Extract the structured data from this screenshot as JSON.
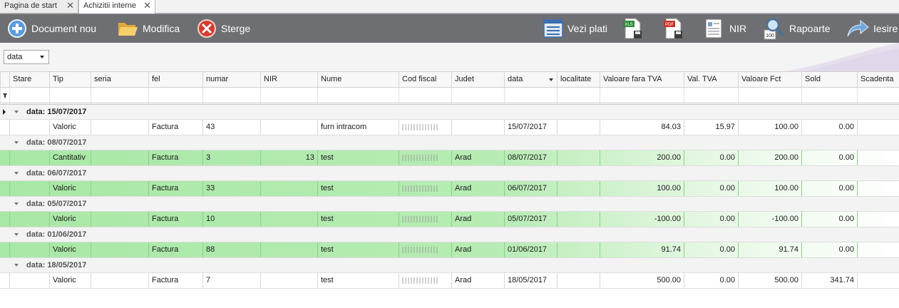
{
  "tabs": [
    {
      "label": "Pagina de start"
    },
    {
      "label": "Achizitii interne"
    }
  ],
  "toolbar": {
    "new_label": "Document nou",
    "edit_label": "Modifica",
    "delete_label": "Sterge",
    "payments_label": "Vezi plati",
    "nir_label": "NIR",
    "reports_label": "Rapoarte",
    "exit_label": "Iesire",
    "xls_badge": "XLS",
    "pdf_badge": "PDF",
    "reports_badge": "100"
  },
  "groupby": {
    "value": "data"
  },
  "columns": [
    "Stare",
    "Tip",
    "seria",
    "fel",
    "numar",
    "NIR",
    "Nume",
    "Cod fiscal",
    "Judet",
    "data",
    "localitate",
    "Valoare fara TVA",
    "Val. TVA",
    "Valoare Fct",
    "Sold",
    "Scadenta"
  ],
  "groups": [
    {
      "label": "data: 15/07/2017",
      "rows": [
        {
          "tip": "Valoric",
          "seria": "",
          "fel": "Factura",
          "numar": "43",
          "nir": "",
          "nume": "furn intracom",
          "judet": "",
          "data": "15/07/2017",
          "localitate": "",
          "val": "84.03",
          "tva": "15.97",
          "fct": "100.00",
          "sold": "0.00",
          "scadenta": "",
          "green": false
        }
      ]
    },
    {
      "label": "data: 08/07/2017",
      "rows": [
        {
          "tip": "Cantitativ",
          "seria": "",
          "fel": "Factura",
          "numar": "3",
          "nir": "13",
          "nume": "test",
          "judet": "Arad",
          "data": "08/07/2017",
          "localitate": "",
          "val": "200.00",
          "tva": "0.00",
          "fct": "200.00",
          "sold": "0.00",
          "scadenta": "",
          "green": true
        }
      ]
    },
    {
      "label": "data: 06/07/2017",
      "rows": [
        {
          "tip": "Valoric",
          "seria": "",
          "fel": "Factura",
          "numar": "33",
          "nir": "",
          "nume": "test",
          "judet": "Arad",
          "data": "06/07/2017",
          "localitate": "",
          "val": "100.00",
          "tva": "0.00",
          "fct": "100.00",
          "sold": "0.00",
          "scadenta": "",
          "green": true
        }
      ]
    },
    {
      "label": "data: 05/07/2017",
      "rows": [
        {
          "tip": "Valoric",
          "seria": "",
          "fel": "Factura",
          "numar": "10",
          "nir": "",
          "nume": "test",
          "judet": "Arad",
          "data": "05/07/2017",
          "localitate": "",
          "val": "-100.00",
          "tva": "0.00",
          "fct": "-100.00",
          "sold": "0.00",
          "scadenta": "",
          "green": true
        }
      ]
    },
    {
      "label": "data: 01/06/2017",
      "rows": [
        {
          "tip": "Valoric",
          "seria": "",
          "fel": "Factura",
          "numar": "88",
          "nir": "",
          "nume": "test",
          "judet": "Arad",
          "data": "01/06/2017",
          "localitate": "",
          "val": "91.74",
          "tva": "0.00",
          "fct": "91.74",
          "sold": "0.00",
          "scadenta": "",
          "green": true
        }
      ]
    },
    {
      "label": "data: 18/05/2017",
      "rows": [
        {
          "tip": "Valoric",
          "seria": "",
          "fel": "Factura",
          "numar": "7",
          "nir": "",
          "nume": "test",
          "judet": "Arad",
          "data": "18/05/2017",
          "localitate": "",
          "val": "500.00",
          "tva": "0.00",
          "fct": "500.00",
          "sold": "341.74",
          "scadenta": "",
          "green": false
        }
      ]
    }
  ],
  "icons": {
    "new": "plus-circle-icon",
    "edit": "folder-open-icon",
    "delete": "delete-x-icon",
    "payments": "list-window-icon",
    "xls": "export-xls-icon",
    "pdf": "export-pdf-icon",
    "nir": "document-list-icon",
    "reports": "magnifier-report-icon",
    "exit": "exit-arrow-icon"
  },
  "colors": {
    "toolbar_bg": "#6e6f72",
    "row_green": "#a8e8a6",
    "group_bg": "#f3f3f3"
  }
}
